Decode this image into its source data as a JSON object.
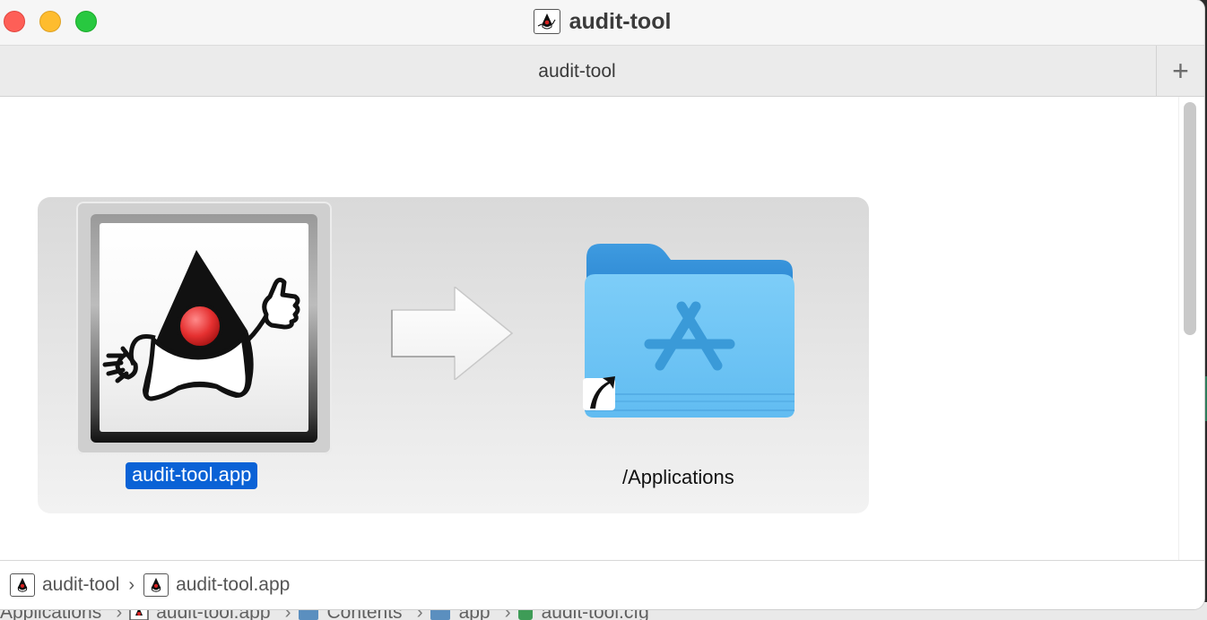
{
  "window": {
    "title": "audit-tool"
  },
  "tabbar": {
    "tab_label": "audit-tool",
    "add_tab_label": "+"
  },
  "installer": {
    "app_label": "audit-tool.app",
    "destination_label": "/Applications"
  },
  "pathbar": {
    "items": [
      {
        "label": "audit-tool",
        "icon": "duke-icon"
      },
      {
        "label": "audit-tool.app",
        "icon": "duke-icon"
      }
    ],
    "separator": "›"
  },
  "background_window_path": {
    "items": [
      {
        "label": "Applications"
      },
      {
        "label": "audit-tool.app",
        "icon": "duke-icon"
      },
      {
        "label": "Contents",
        "icon": "folder-icon"
      },
      {
        "label": "app",
        "icon": "folder-icon"
      },
      {
        "label": "audit-tool.cfg",
        "icon": "config-file-icon"
      }
    ],
    "separator": "›"
  },
  "colors": {
    "selection": "#0a62d6",
    "folder_blue": "#6cc4f5",
    "close": "#fe5f57",
    "minimize": "#febc2e",
    "zoom": "#28c840"
  }
}
